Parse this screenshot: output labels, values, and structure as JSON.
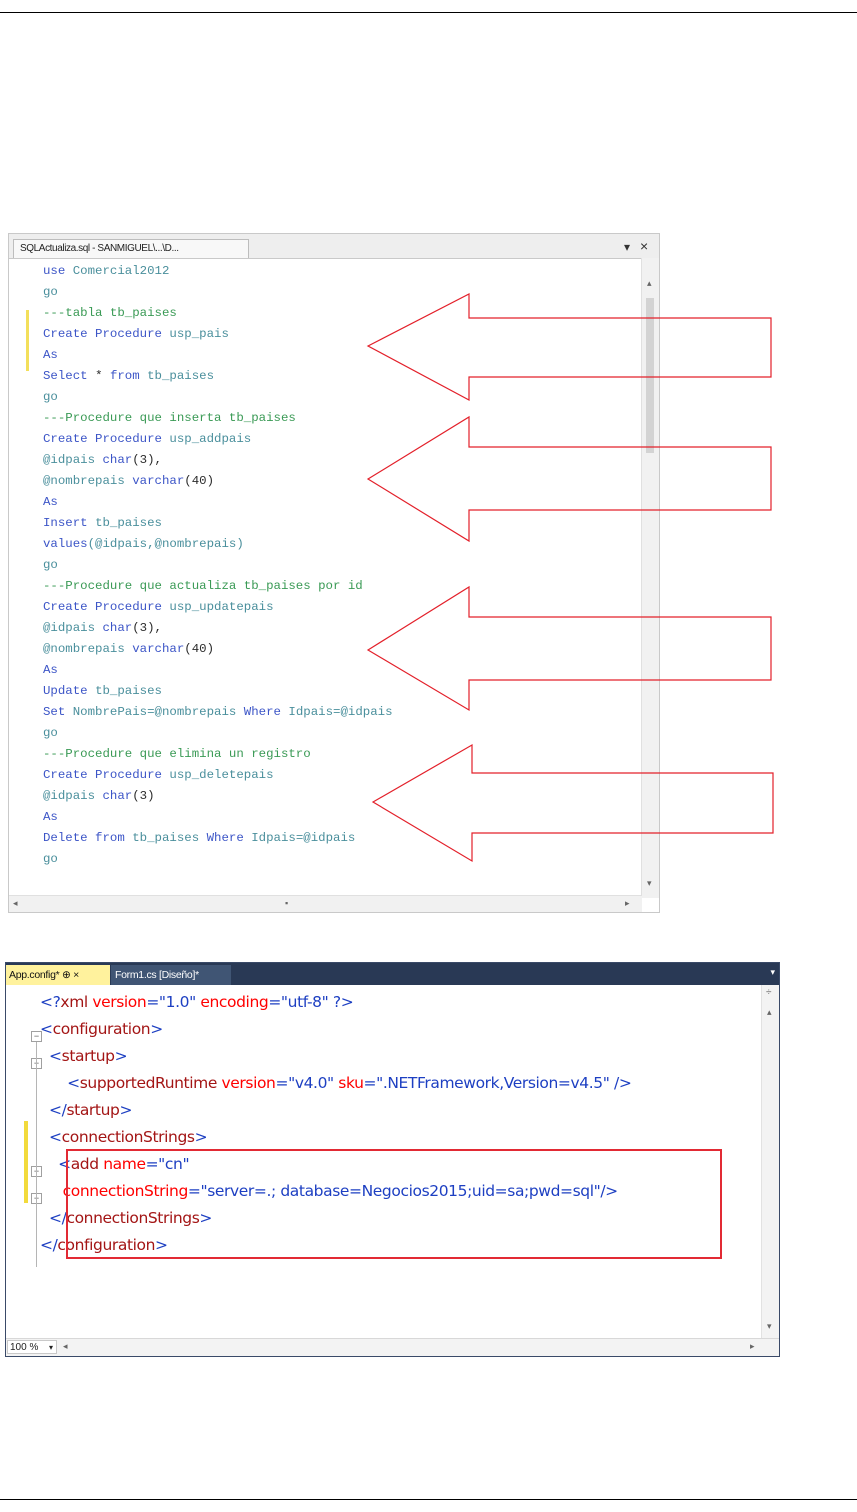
{
  "sql_editor": {
    "tab_title": "SQLActualiza.sql - SANMIGUEL\\...\\D...",
    "dropdown_glyph": "▾",
    "close_glyph": "×",
    "lines": [
      [
        {
          "t": "use ",
          "c": "kw"
        },
        {
          "t": "Comercial2012",
          "c": "pr"
        }
      ],
      [
        {
          "t": "go",
          "c": "pr"
        }
      ],
      [
        {
          "t": "---tabla tb_paises",
          "c": "cm"
        }
      ],
      [
        {
          "t": "Create Procedure ",
          "c": "kw"
        },
        {
          "t": "usp_pais",
          "c": "pr"
        }
      ],
      [
        {
          "t": "As",
          "c": "kw"
        }
      ],
      [
        {
          "t": "Select ",
          "c": "kw"
        },
        {
          "t": "* ",
          "c": "tx"
        },
        {
          "t": "from ",
          "c": "kw"
        },
        {
          "t": "tb_paises",
          "c": "pr"
        }
      ],
      [
        {
          "t": "go",
          "c": "pr"
        }
      ],
      [
        {
          "t": "---Procedure que inserta tb_paises",
          "c": "cm"
        }
      ],
      [
        {
          "t": "Create Procedure ",
          "c": "kw"
        },
        {
          "t": "usp_addpais",
          "c": "pr"
        }
      ],
      [
        {
          "t": "@idpais ",
          "c": "pr"
        },
        {
          "t": "char",
          "c": "kw"
        },
        {
          "t": "(3),",
          "c": "tx"
        }
      ],
      [
        {
          "t": "@nombrepais ",
          "c": "pr"
        },
        {
          "t": "varchar",
          "c": "kw"
        },
        {
          "t": "(40)",
          "c": "tx"
        }
      ],
      [
        {
          "t": "As",
          "c": "kw"
        }
      ],
      [
        {
          "t": "Insert ",
          "c": "kw"
        },
        {
          "t": "tb_paises",
          "c": "pr"
        }
      ],
      [
        {
          "t": "values",
          "c": "kw"
        },
        {
          "t": "(@idpais,@nombrepais)",
          "c": "pr"
        }
      ],
      [
        {
          "t": "go",
          "c": "pr"
        }
      ],
      [
        {
          "t": "---Procedure que actualiza tb_paises por id",
          "c": "cm"
        }
      ],
      [
        {
          "t": "Create Procedure ",
          "c": "kw"
        },
        {
          "t": "usp_updatepais",
          "c": "pr"
        }
      ],
      [
        {
          "t": "@idpais ",
          "c": "pr"
        },
        {
          "t": "char",
          "c": "kw"
        },
        {
          "t": "(3),",
          "c": "tx"
        }
      ],
      [
        {
          "t": "@nombrepais ",
          "c": "pr"
        },
        {
          "t": "varchar",
          "c": "kw"
        },
        {
          "t": "(40)",
          "c": "tx"
        }
      ],
      [
        {
          "t": "As",
          "c": "kw"
        }
      ],
      [
        {
          "t": "Update ",
          "c": "kw"
        },
        {
          "t": "tb_paises",
          "c": "pr"
        }
      ],
      [
        {
          "t": "Set ",
          "c": "kw"
        },
        {
          "t": "NombrePais=@nombrepais ",
          "c": "pr"
        },
        {
          "t": "Where ",
          "c": "kw"
        },
        {
          "t": "Idpais=@idpais",
          "c": "pr"
        }
      ],
      [
        {
          "t": "go",
          "c": "pr"
        }
      ],
      [
        {
          "t": "---Procedure que elimina un registro",
          "c": "cm"
        }
      ],
      [
        {
          "t": "Create Procedure ",
          "c": "kw"
        },
        {
          "t": "usp_deletepais",
          "c": "pr"
        }
      ],
      [
        {
          "t": "@idpais ",
          "c": "pr"
        },
        {
          "t": "char",
          "c": "kw"
        },
        {
          "t": "(3)",
          "c": "tx"
        }
      ],
      [
        {
          "t": "As",
          "c": "kw"
        }
      ],
      [
        {
          "t": "Delete from ",
          "c": "kw"
        },
        {
          "t": "tb_paises ",
          "c": "pr"
        },
        {
          "t": "Where ",
          "c": "kw"
        },
        {
          "t": "Idpais=@idpais",
          "c": "pr"
        }
      ],
      [
        {
          "t": "go",
          "c": "pr"
        }
      ]
    ]
  },
  "annotation_color": "#e3202a",
  "xml_editor": {
    "tab_active": "App.config*  ⊕  ×",
    "tab_inactive": "Form1.cs [Diseño]*",
    "zoom": "100 %",
    "lines": [
      [
        {
          "t": "<?",
          "c": "xb"
        },
        {
          "t": "xml ",
          "c": "xt"
        },
        {
          "t": "version",
          "c": "xa"
        },
        {
          "t": "=\"1.0\" ",
          "c": "xv"
        },
        {
          "t": "encoding",
          "c": "xa"
        },
        {
          "t": "=\"utf-8\" ",
          "c": "xv"
        },
        {
          "t": "?>",
          "c": "xb"
        }
      ],
      [
        {
          "t": "<",
          "c": "xb"
        },
        {
          "t": "configuration",
          "c": "xt"
        },
        {
          "t": ">",
          "c": "xb"
        }
      ],
      [
        {
          "t": "  <",
          "c": "xb"
        },
        {
          "t": "startup",
          "c": "xt"
        },
        {
          "t": ">",
          "c": "xb"
        }
      ],
      [
        {
          "t": "      <",
          "c": "xb"
        },
        {
          "t": "supportedRuntime ",
          "c": "xt"
        },
        {
          "t": "version",
          "c": "xa"
        },
        {
          "t": "=\"v4.0\" ",
          "c": "xv"
        },
        {
          "t": "sku",
          "c": "xa"
        },
        {
          "t": "=\".NETFramework,Version=v4.5\" ",
          "c": "xv"
        },
        {
          "t": "/>",
          "c": "xb"
        }
      ],
      [
        {
          "t": "  </",
          "c": "xb"
        },
        {
          "t": "startup",
          "c": "xt"
        },
        {
          "t": ">",
          "c": "xb"
        }
      ],
      [
        {
          "t": "  <",
          "c": "xb"
        },
        {
          "t": "connectionStrings",
          "c": "xt"
        },
        {
          "t": ">",
          "c": "xb"
        }
      ],
      [
        {
          "t": "    <",
          "c": "xb"
        },
        {
          "t": "add ",
          "c": "xt"
        },
        {
          "t": "name",
          "c": "xa"
        },
        {
          "t": "=\"cn\"",
          "c": "xv"
        }
      ],
      [
        {
          "t": "     ",
          "c": "xb"
        },
        {
          "t": "connectionString",
          "c": "xa"
        },
        {
          "t": "=\"server=.; database=Negocios2015;uid=sa;pwd=sql\"",
          "c": "xv"
        },
        {
          "t": "/>",
          "c": "xb"
        }
      ],
      [
        {
          "t": "  </",
          "c": "xb"
        },
        {
          "t": "connectionStrings",
          "c": "xt"
        },
        {
          "t": ">",
          "c": "xb"
        }
      ],
      [
        {
          "t": "</",
          "c": "xb"
        },
        {
          "t": "configuration",
          "c": "xt"
        },
        {
          "t": ">",
          "c": "xb"
        }
      ]
    ]
  }
}
